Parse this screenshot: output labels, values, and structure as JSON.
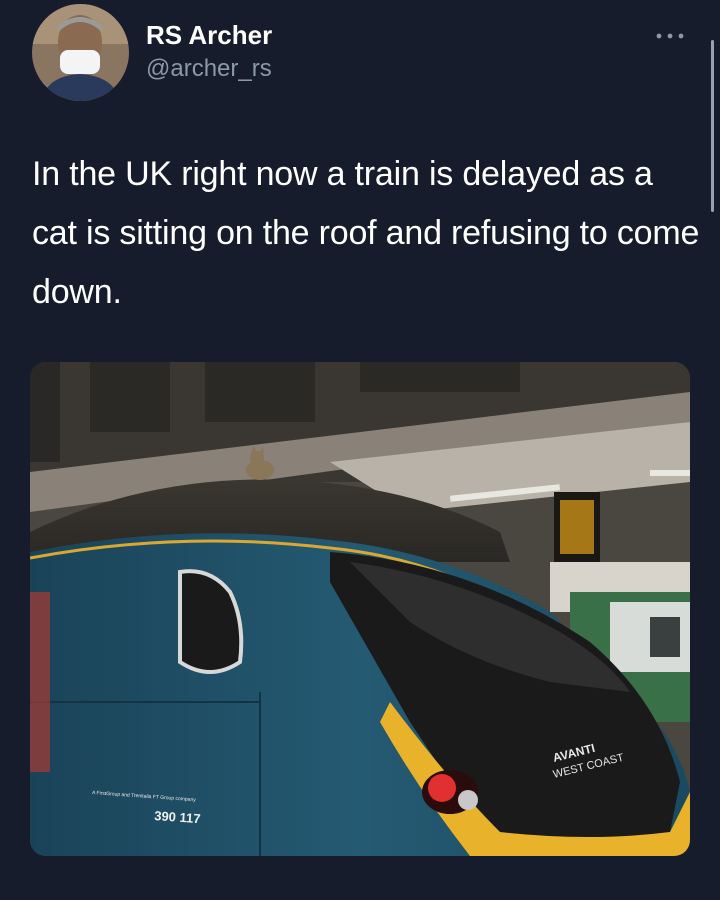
{
  "tweet": {
    "author": {
      "display_name": "RS Archer",
      "handle": "@archer_rs",
      "avatar_icon": "avatar-person-with-mask"
    },
    "more_icon": "more-dots-icon",
    "text": "In the UK right now a train is delayed as a cat is sitting on the roof and refusing to come down.",
    "media": {
      "labels": {
        "brand_line1": "AVANTI",
        "brand_line2": "WEST COAST",
        "unit_number": "390 117",
        "small_print": "A FirstGroup and Trenitalia FT Group company"
      }
    }
  },
  "colors": {
    "background": "#161c2c",
    "text_primary": "#ffffff",
    "text_secondary": "#8b98a5",
    "train_teal": "#1c4a5e",
    "train_yellow": "#e8b22a"
  }
}
